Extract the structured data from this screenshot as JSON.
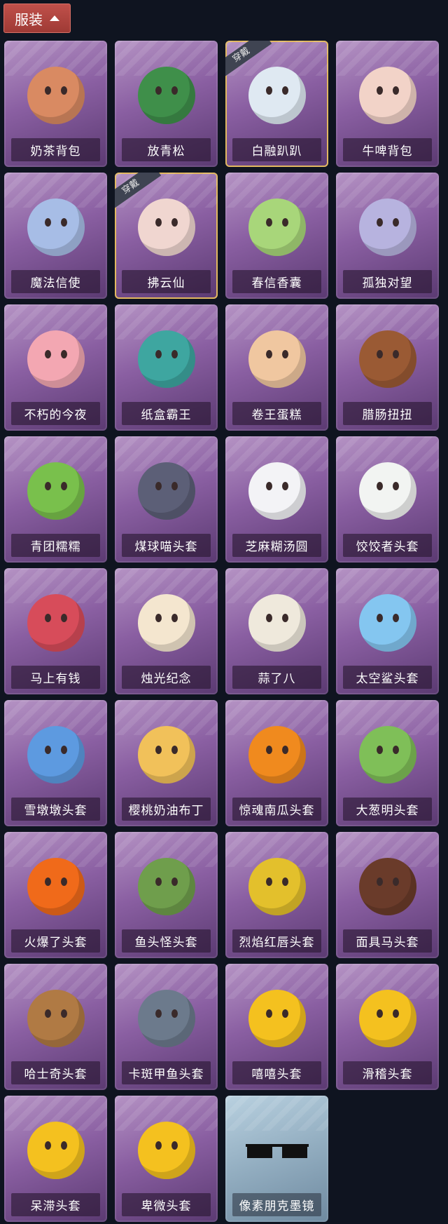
{
  "header": {
    "label": "服装"
  },
  "items": [
    {
      "name": "奶茶背包",
      "color": "#d98a62"
    },
    {
      "name": "放青松",
      "color": "#3f8f4a"
    },
    {
      "name": "白融趴趴",
      "color": "#dfe9f2",
      "badge": "穿戴"
    },
    {
      "name": "牛啤背包",
      "color": "#f2d3c8"
    },
    {
      "name": "魔法信使",
      "color": "#a7bde6"
    },
    {
      "name": "拂云仙",
      "color": "#f0d6d0",
      "badge": "穿戴"
    },
    {
      "name": "春信香囊",
      "color": "#a8d67a"
    },
    {
      "name": "孤独对望",
      "color": "#b7b3df"
    },
    {
      "name": "不朽的今夜",
      "color": "#f3a7b2"
    },
    {
      "name": "纸盒霸王",
      "color": "#3ea6a0"
    },
    {
      "name": "卷王蛋糕",
      "color": "#f0c7a0"
    },
    {
      "name": "腊肠扭扭",
      "color": "#9a5a34"
    },
    {
      "name": "青团糯糯",
      "color": "#79c04c"
    },
    {
      "name": "煤球喵头套",
      "color": "#5c5f77"
    },
    {
      "name": "芝麻糊汤圆",
      "color": "#f3f3f6"
    },
    {
      "name": "饺饺者头套",
      "color": "#f2f4f2"
    },
    {
      "name": "马上有钱",
      "color": "#d74c5a"
    },
    {
      "name": "烛光纪念",
      "color": "#f4e6cf"
    },
    {
      "name": "蒜了八",
      "color": "#efe9dc"
    },
    {
      "name": "太空鲨头套",
      "color": "#84c6f0"
    },
    {
      "name": "雪墩墩头套",
      "color": "#5d9ae0"
    },
    {
      "name": "樱桃奶油布丁",
      "color": "#f1c15a"
    },
    {
      "name": "惊魂南瓜头套",
      "color": "#f08a1e"
    },
    {
      "name": "大葱明头套",
      "color": "#7fbf58"
    },
    {
      "name": "火爆了头套",
      "color": "#f06a1a"
    },
    {
      "name": "鱼头怪头套",
      "color": "#6f9e4c"
    },
    {
      "name": "烈焰红唇头套",
      "color": "#e3c02c"
    },
    {
      "name": "面具马头套",
      "color": "#6a3b2a"
    },
    {
      "name": "哈士奇头套",
      "color": "#b07a44"
    },
    {
      "name": "卡斑甲鱼头套",
      "color": "#6c7a8c"
    },
    {
      "name": "嘻嘻头套",
      "color": "#f4c11f"
    },
    {
      "name": "滑稽头套",
      "color": "#f4c11f"
    },
    {
      "name": "呆滞头套",
      "color": "#f4c11f"
    },
    {
      "name": "卑微头套",
      "color": "#f4c11f"
    },
    {
      "name": "像素朋克墨镜",
      "color": "#111111",
      "special": true
    }
  ]
}
